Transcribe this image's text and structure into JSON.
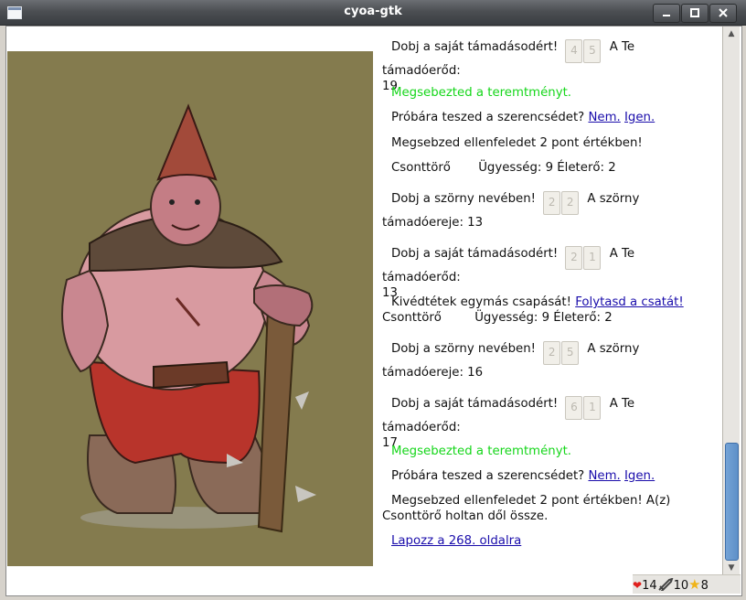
{
  "window": {
    "title": "cyoa-gtk"
  },
  "log": [
    {
      "type": "roll",
      "before": "Dobj a saját támadásodért!",
      "dice": [
        "4",
        "5"
      ],
      "after": "A Te támadóerőd:",
      "tail": "19"
    },
    {
      "type": "text",
      "text": "Megsebezted a teremtményt.",
      "green": true
    },
    {
      "type": "question",
      "text": "Próbára teszed a szerencsédet?",
      "no": "Nem.",
      "yes": "Igen."
    },
    {
      "type": "text",
      "text": "Megsebzed ellenfeledet 2 pont értékben!"
    },
    {
      "type": "stats",
      "name": "Csonttörő",
      "stats": "Ügyesség: 9 Életerő: 2"
    },
    {
      "type": "roll",
      "before": "Dobj a szörny nevében!",
      "dice": [
        "2",
        "2"
      ],
      "after": "A szörny",
      "tail": "támadóereje: 13"
    },
    {
      "type": "roll",
      "before": "Dobj a saját támadásodért!",
      "dice": [
        "2",
        "1"
      ],
      "after": "A Te támadóerőd:",
      "tail": "13"
    },
    {
      "type": "parry",
      "text": "Kivédtétek egymás csapását!",
      "link": "Folytasd a csatát!",
      "name": "Csonttörő",
      "stats": "Ügyesség: 9 Életerő: 2"
    },
    {
      "type": "roll",
      "before": "Dobj a szörny nevében!",
      "dice": [
        "2",
        "5"
      ],
      "after": "A szörny",
      "tail": "támadóereje: 16"
    },
    {
      "type": "roll",
      "before": "Dobj a saját támadásodért!",
      "dice": [
        "6",
        "1"
      ],
      "after": "A Te támadóerőd:",
      "tail": "17"
    },
    {
      "type": "text",
      "text": "Megsebezted a teremtményt.",
      "green": true
    },
    {
      "type": "question",
      "text": "Próbára teszed a szerencsédet?",
      "no": "Nem.",
      "yes": "Igen."
    },
    {
      "type": "wrap",
      "text": "Megsebzed ellenfeledet 2 pont értékben! A(z)",
      "tail": "Csonttörő holtan dől össze."
    },
    {
      "type": "link",
      "text": "Lapozz a 268. oldalra"
    }
  ],
  "status": {
    "health": "14",
    "skill": "10",
    "luck": "8",
    "health_icon": "heart-icon",
    "skill_icon": "sword-icon",
    "luck_icon": "star-icon"
  },
  "colors": {
    "olive_background": "#847b4e",
    "success_text": "#15d61a",
    "link": "#1a0dab"
  }
}
